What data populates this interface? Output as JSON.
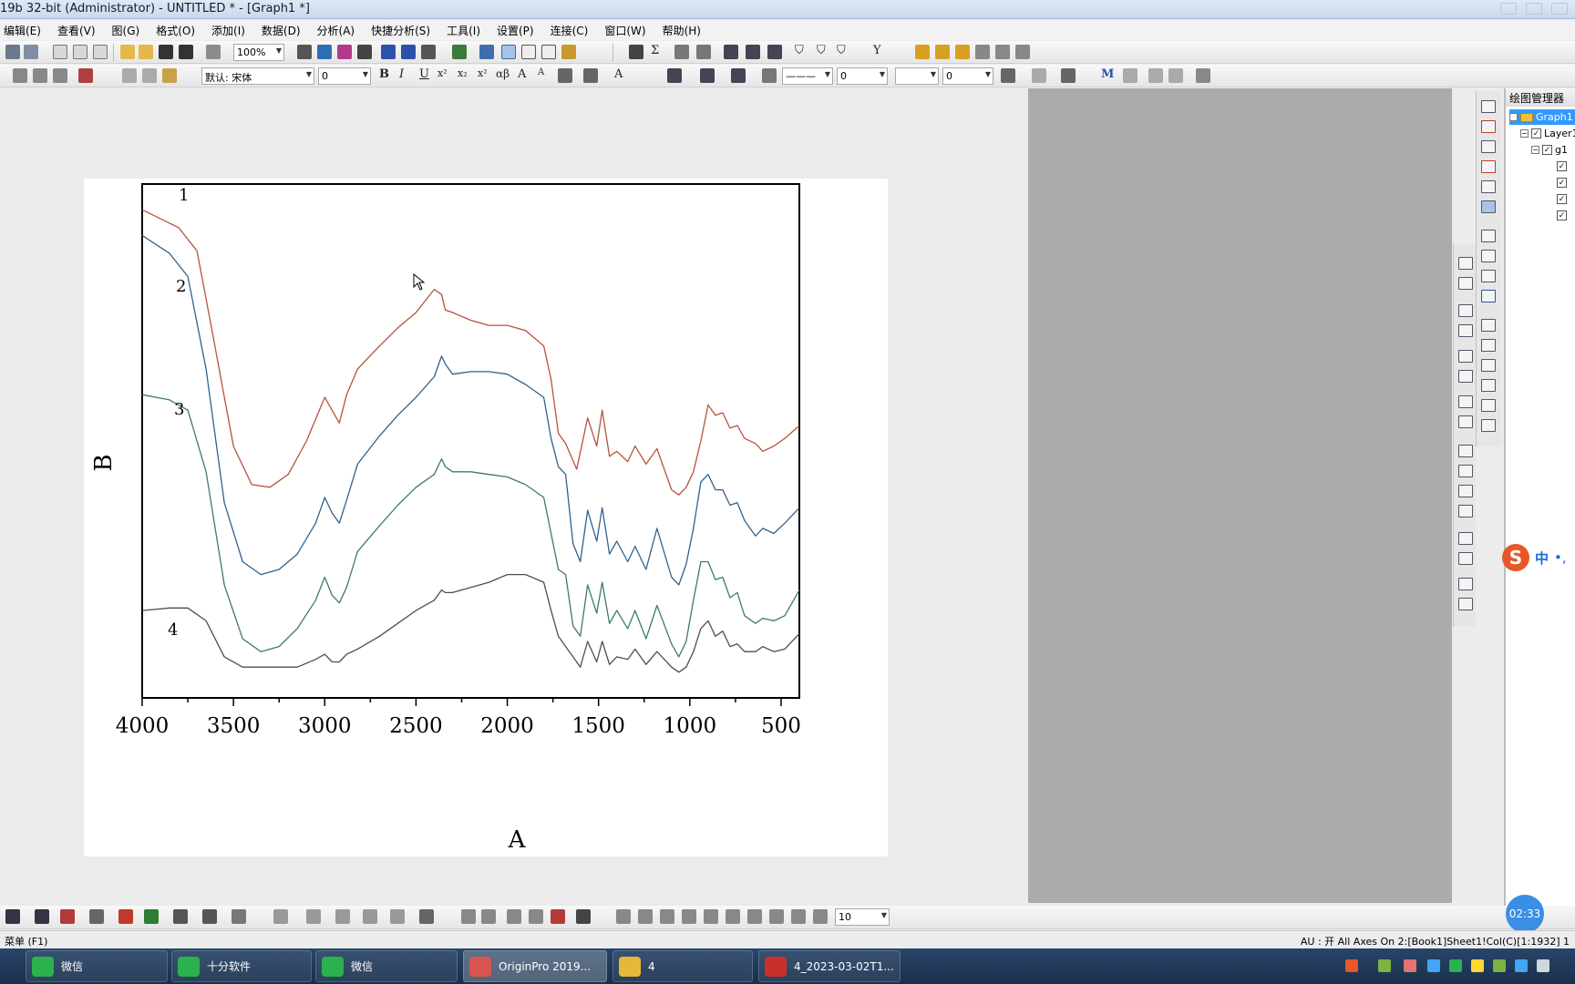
{
  "window": {
    "title": "19b 32-bit (Administrator) - UNTITLED * - [Graph1 *]"
  },
  "menu": [
    {
      "label": "编辑(E)"
    },
    {
      "label": "查看(V)"
    },
    {
      "label": "图(G)"
    },
    {
      "label": "格式(O)"
    },
    {
      "label": "添加(I)"
    },
    {
      "label": "数据(D)"
    },
    {
      "label": "分析(A)"
    },
    {
      "label": "快捷分析(S)"
    },
    {
      "label": "工具(I)"
    },
    {
      "label": "设置(P)"
    },
    {
      "label": "连接(C)"
    },
    {
      "label": "窗口(W)"
    },
    {
      "label": "帮助(H)"
    }
  ],
  "toolbar": {
    "zoom_value": "100%",
    "font_value": "默认: 宋体",
    "font_size_value": "0",
    "line_width_value": "0",
    "line_width2_value": "0",
    "bottom_size_value": "10"
  },
  "plot_manager": {
    "title": "绘图管理器",
    "graph": "Graph1",
    "layer": "Layer1",
    "group": "g1"
  },
  "ime": {
    "logo": "S",
    "mode": "中",
    "punct": "•,"
  },
  "clock": "02:33",
  "status": {
    "left": "菜单 (F1)",
    "right": "AU : 开  All Axes On  2:[Book1]Sheet1!Col(C)[1:1932]  1"
  },
  "taskbar": [
    {
      "label": "微信",
      "color": "#2bb24c"
    },
    {
      "label": "十分软件",
      "color": "#2bb24c"
    },
    {
      "label": "微信",
      "color": "#2bb24c"
    },
    {
      "label": "OriginPro 2019...",
      "color": "#d9534f"
    },
    {
      "label": "4",
      "color": "#e6b73a"
    },
    {
      "label": "4_2023-03-02T1...",
      "color": "#c9302c"
    }
  ],
  "chart_data": {
    "type": "line",
    "xlabel": "A",
    "ylabel": "B",
    "xlim": [
      4000,
      400
    ],
    "x_reversed": true,
    "ylim": [
      0,
      100
    ],
    "y_ticks_hidden": true,
    "x_ticks": [
      4000,
      3500,
      3000,
      2500,
      2000,
      1500,
      1000,
      500
    ],
    "x_tick_labels": [
      "4000",
      "3500",
      "3000",
      "2500",
      "2000",
      "1500",
      "1000",
      "500"
    ],
    "series": [
      {
        "name": "1",
        "color": "#b5533c",
        "x": [
          4000,
          3800,
          3700,
          3620,
          3500,
          3400,
          3300,
          3200,
          3100,
          3000,
          2960,
          2920,
          2880,
          2820,
          2700,
          2600,
          2500,
          2400,
          2360,
          2340,
          2300,
          2200,
          2100,
          2000,
          1900,
          1800,
          1760,
          1720,
          1680,
          1620,
          1560,
          1510,
          1480,
          1440,
          1400,
          1340,
          1300,
          1240,
          1180,
          1100,
          1060,
          1020,
          980,
          940,
          900,
          860,
          820,
          780,
          740,
          700,
          640,
          600,
          540,
          480,
          400
        ],
        "y": [
          95.0,
          91.5,
          87.0,
          72.0,
          49.0,
          41.5,
          41.0,
          43.5,
          50.0,
          58.5,
          56.0,
          53.5,
          59.0,
          64.0,
          68.5,
          72.0,
          75.0,
          79.5,
          78.5,
          75.5,
          75.0,
          73.5,
          72.5,
          72.5,
          71.5,
          68.5,
          62.0,
          51.5,
          49.5,
          44.5,
          54.5,
          49.0,
          56.0,
          47.0,
          48.0,
          46.0,
          49.0,
          45.5,
          48.5,
          40.5,
          39.5,
          41.0,
          44.0,
          50.0,
          57.0,
          55.0,
          55.5,
          52.5,
          53.0,
          50.5,
          49.5,
          48.0,
          49.0,
          50.5,
          53.0
        ]
      },
      {
        "name": "2",
        "color": "#2f628f",
        "x": [
          4000,
          3850,
          3750,
          3650,
          3550,
          3450,
          3350,
          3250,
          3150,
          3050,
          3000,
          2960,
          2920,
          2880,
          2820,
          2700,
          2600,
          2500,
          2400,
          2360,
          2340,
          2300,
          2200,
          2100,
          2000,
          1900,
          1800,
          1760,
          1720,
          1680,
          1640,
          1600,
          1560,
          1510,
          1480,
          1440,
          1400,
          1340,
          1300,
          1240,
          1180,
          1100,
          1060,
          1020,
          980,
          940,
          900,
          860,
          820,
          780,
          740,
          700,
          640,
          600,
          540,
          480,
          400
        ],
        "y": [
          90.0,
          86.5,
          82.0,
          64.0,
          38.0,
          26.5,
          24.0,
          25.0,
          28.0,
          34.0,
          39.0,
          36.0,
          34.0,
          38.5,
          45.5,
          51.0,
          55.0,
          58.5,
          62.5,
          66.5,
          65.0,
          63.0,
          63.5,
          63.5,
          63.0,
          61.0,
          58.5,
          50.5,
          45.0,
          43.5,
          30.0,
          26.5,
          36.5,
          30.5,
          37.0,
          28.0,
          30.5,
          26.5,
          29.5,
          25.0,
          33.0,
          23.5,
          22.0,
          26.0,
          33.0,
          42.0,
          43.5,
          40.5,
          40.5,
          37.5,
          38.0,
          34.5,
          31.5,
          33.0,
          32.0,
          34.0,
          37.0
        ]
      },
      {
        "name": "3",
        "color": "#3f7c5e",
        "x": [
          4000,
          3850,
          3750,
          3650,
          3550,
          3450,
          3350,
          3250,
          3150,
          3050,
          3000,
          2960,
          2920,
          2880,
          2820,
          2700,
          2600,
          2500,
          2400,
          2360,
          2340,
          2300,
          2200,
          2100,
          2000,
          1900,
          1800,
          1760,
          1720,
          1680,
          1640,
          1600,
          1560,
          1510,
          1480,
          1440,
          1400,
          1340,
          1300,
          1240,
          1180,
          1100,
          1060,
          1020,
          980,
          940,
          900,
          860,
          820,
          780,
          740,
          700,
          640,
          600,
          540,
          480,
          400
        ],
        "y": [
          59.0,
          58.0,
          56.0,
          44.0,
          22.0,
          11.5,
          9.0,
          10.0,
          13.5,
          19.0,
          23.5,
          20.0,
          18.5,
          21.5,
          28.5,
          33.5,
          37.5,
          41.0,
          43.5,
          46.5,
          45.0,
          44.0,
          44.0,
          43.5,
          43.0,
          41.5,
          39.0,
          32.0,
          25.0,
          24.0,
          14.0,
          12.0,
          22.0,
          16.5,
          22.5,
          14.5,
          17.0,
          13.5,
          17.0,
          11.5,
          18.0,
          10.5,
          8.0,
          11.0,
          19.0,
          26.5,
          26.5,
          23.0,
          23.5,
          19.5,
          20.5,
          16.0,
          14.5,
          15.5,
          15.0,
          16.0,
          21.0
        ]
      },
      {
        "name": "4",
        "color": "#4e4e4e",
        "x": [
          4000,
          3850,
          3750,
          3650,
          3550,
          3450,
          3350,
          3250,
          3150,
          3050,
          3000,
          2960,
          2920,
          2880,
          2820,
          2700,
          2600,
          2500,
          2400,
          2360,
          2340,
          2300,
          2200,
          2100,
          2000,
          1900,
          1800,
          1760,
          1720,
          1680,
          1640,
          1600,
          1560,
          1510,
          1480,
          1440,
          1400,
          1340,
          1300,
          1240,
          1180,
          1100,
          1060,
          1020,
          980,
          940,
          900,
          860,
          820,
          780,
          740,
          700,
          640,
          600,
          540,
          480,
          400
        ],
        "y": [
          17.0,
          17.5,
          17.5,
          15.0,
          8.0,
          6.0,
          6.0,
          6.0,
          6.0,
          7.5,
          8.5,
          7.0,
          7.0,
          8.5,
          9.5,
          12.0,
          14.5,
          17.0,
          19.0,
          21.0,
          20.5,
          20.5,
          21.5,
          22.5,
          24.0,
          24.0,
          22.5,
          17.0,
          12.0,
          10.0,
          8.0,
          6.0,
          11.0,
          7.0,
          11.0,
          6.5,
          8.0,
          7.5,
          9.5,
          6.5,
          9.0,
          6.0,
          5.0,
          6.0,
          9.0,
          13.5,
          15.0,
          12.0,
          13.0,
          10.0,
          10.5,
          9.0,
          9.0,
          10.0,
          9.0,
          9.5,
          12.5
        ]
      }
    ]
  }
}
